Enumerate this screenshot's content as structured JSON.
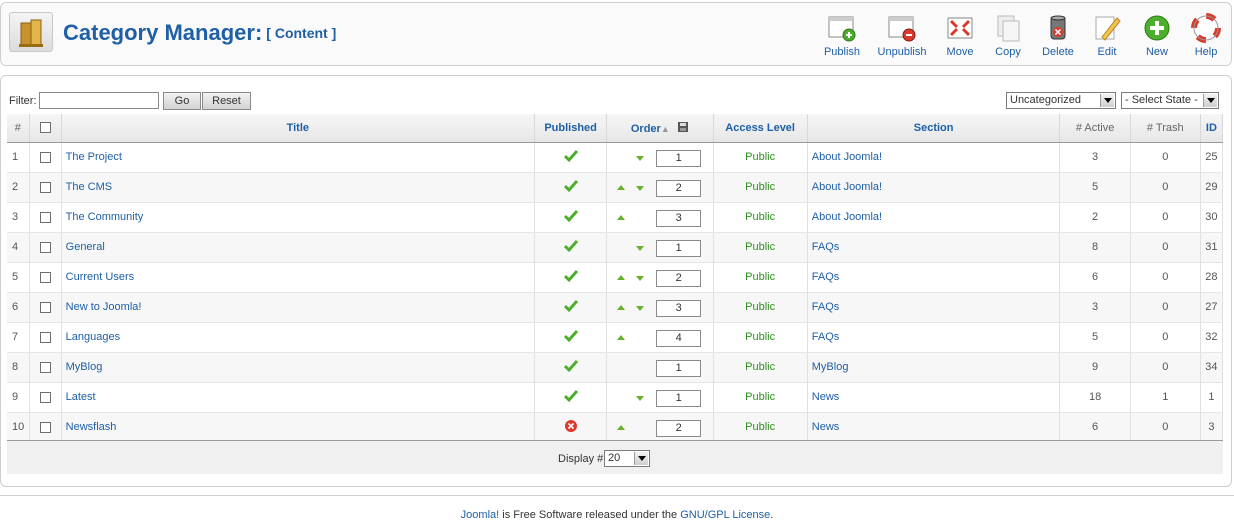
{
  "header": {
    "title": "Category Manager:",
    "subtitle": "[ Content ]"
  },
  "toolbar": {
    "buttons": [
      {
        "label": "Publish",
        "icon": "publish-icon"
      },
      {
        "label": "Unpublish",
        "icon": "unpublish-icon"
      },
      {
        "label": "Move",
        "icon": "move-icon"
      },
      {
        "label": "Copy",
        "icon": "copy-icon"
      },
      {
        "label": "Delete",
        "icon": "delete-icon"
      },
      {
        "label": "Edit",
        "icon": "edit-icon"
      },
      {
        "label": "New",
        "icon": "new-icon"
      },
      {
        "label": "Help",
        "icon": "help-icon"
      }
    ]
  },
  "filter": {
    "label": "Filter:",
    "value": "",
    "go_label": "Go",
    "reset_label": "Reset",
    "section_select": "Uncategorized",
    "state_select": "- Select State -"
  },
  "table": {
    "headers": {
      "num": "#",
      "title": "Title",
      "published": "Published",
      "order": "Order",
      "access": "Access Level",
      "section": "Section",
      "active": "# Active",
      "trash": "# Trash",
      "id": "ID"
    },
    "rows": [
      {
        "num": "1",
        "title": "The Project",
        "published": true,
        "up": false,
        "down": true,
        "order": "1",
        "access": "Public",
        "section": "About Joomla!",
        "active": "3",
        "trash": "0",
        "id": "25"
      },
      {
        "num": "2",
        "title": "The CMS",
        "published": true,
        "up": true,
        "down": true,
        "order": "2",
        "access": "Public",
        "section": "About Joomla!",
        "active": "5",
        "trash": "0",
        "id": "29"
      },
      {
        "num": "3",
        "title": "The Community",
        "published": true,
        "up": true,
        "down": false,
        "order": "3",
        "access": "Public",
        "section": "About Joomla!",
        "active": "2",
        "trash": "0",
        "id": "30"
      },
      {
        "num": "4",
        "title": "General",
        "published": true,
        "up": false,
        "down": true,
        "order": "1",
        "access": "Public",
        "section": "FAQs",
        "active": "8",
        "trash": "0",
        "id": "31"
      },
      {
        "num": "5",
        "title": "Current Users",
        "published": true,
        "up": true,
        "down": true,
        "order": "2",
        "access": "Public",
        "section": "FAQs",
        "active": "6",
        "trash": "0",
        "id": "28"
      },
      {
        "num": "6",
        "title": "New to Joomla!",
        "published": true,
        "up": true,
        "down": true,
        "order": "3",
        "access": "Public",
        "section": "FAQs",
        "active": "3",
        "trash": "0",
        "id": "27"
      },
      {
        "num": "7",
        "title": "Languages",
        "published": true,
        "up": true,
        "down": false,
        "order": "4",
        "access": "Public",
        "section": "FAQs",
        "active": "5",
        "trash": "0",
        "id": "32"
      },
      {
        "num": "8",
        "title": "MyBlog",
        "published": true,
        "up": false,
        "down": false,
        "order": "1",
        "access": "Public",
        "section": "MyBlog",
        "active": "9",
        "trash": "0",
        "id": "34"
      },
      {
        "num": "9",
        "title": "Latest",
        "published": true,
        "up": false,
        "down": true,
        "order": "1",
        "access": "Public",
        "section": "News",
        "active": "18",
        "trash": "1",
        "id": "1"
      },
      {
        "num": "10",
        "title": "Newsflash",
        "published": false,
        "up": true,
        "down": false,
        "order": "2",
        "access": "Public",
        "section": "News",
        "active": "6",
        "trash": "0",
        "id": "3"
      }
    ]
  },
  "pagination": {
    "display_label": "Display #",
    "display_value": "20"
  },
  "footer": {
    "brand": "Joomla!",
    "text": " is Free Software released under the ",
    "license": "GNU/GPL License",
    "end": "."
  },
  "colors": {
    "accent": "#1e5fa6",
    "access_green": "#2f8f1f",
    "arrow_green": "#67b22b",
    "unpublish_red": "#d93a2b"
  }
}
